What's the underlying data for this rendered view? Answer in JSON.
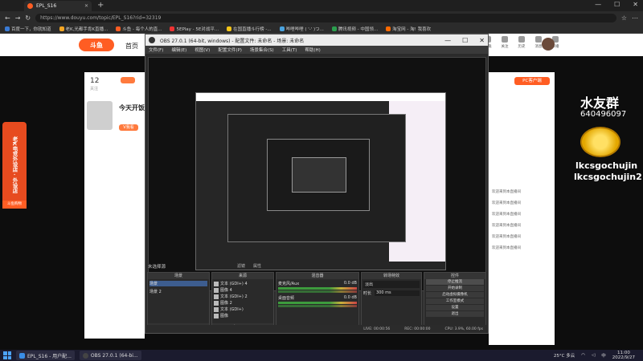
{
  "browser": {
    "tab_title": "EPL_S16",
    "new_tab": "+",
    "url": "https://www.douyu.com/topic/EPL_S16?rid=32319",
    "bookmarks": [
      "百度一下，你就知道",
      "老K,光都手肯K直播...",
      "斗鱼 - 每个人的直...",
      "5EPlay - 5E对战平...",
      "在国直播斗行榜 -...",
      "哔哩哔哩 ( '-' )つ...",
      "腾讯视频 - 中国领...",
      "淘宝网 - 淘! 我喜欢"
    ],
    "window_controls": [
      "—",
      "☐",
      "✕"
    ]
  },
  "site": {
    "logo": "斗鱼",
    "home": "首页",
    "header_icons": [
      "下载",
      "关注",
      "历史",
      "消息",
      "开播"
    ],
    "fans_count": "12",
    "fans_label": "关注",
    "today_title": "今天开饭",
    "v_button": "V我看",
    "left_banner": "老K电竞外设店 · 外设店",
    "left_banner_btn": "斗鱼购物",
    "pc_client_btn": "PC客户端",
    "chat_lines": [
      "欢迎来到本直播间",
      "欢迎来到本直播间",
      "欢迎来到本直播间",
      "欢迎来到本直播间",
      "欢迎来到本直播间",
      "欢迎来到本直播间"
    ],
    "overlay_name": "水友群",
    "overlay_id": "640496097",
    "overlay_user1": "lkcsgochujin",
    "overlay_user2": "lkcsgochujin2"
  },
  "obs": {
    "title": "OBS 27.0.1 (64-bit, windows) - 配置文件: 未命名 - 场景: 未命名",
    "menu": [
      "文件(F)",
      "编辑(E)",
      "视图(V)",
      "配置文件(P)",
      "场景集合(S)",
      "工具(T)",
      "帮助(H)"
    ],
    "no_scene": "未选择源",
    "filters": "滤镜",
    "properties": "属性",
    "docks": {
      "scenes": {
        "title": "场景",
        "items": [
          "场景",
          "场景 2"
        ]
      },
      "sources": {
        "title": "来源",
        "items": [
          "文本 (GDI+) 4",
          "图像 4",
          "文本 (GDI+) 2",
          "图像 2",
          "文本 (GDI+)",
          "图像"
        ]
      },
      "mixer": {
        "title": "混音器",
        "tracks": [
          {
            "name": "麦克风/Aux",
            "db": "0.0 dB"
          },
          {
            "name": "桌面音频",
            "db": "0.0 dB"
          }
        ]
      },
      "transitions": {
        "title": "转场特效",
        "type": "淡出",
        "duration_label": "时长",
        "duration": "300 ms"
      },
      "controls": {
        "title": "控件",
        "buttons": [
          "停止推流",
          "开始录制",
          "启动虚拟摄像机",
          "工作室模式",
          "设置",
          "退出"
        ]
      }
    },
    "footer": {
      "live": "LIVE: 00:00:56",
      "rec": "REC: 00:00:00",
      "cpu": "CPU: 3.9%, 60.00 fps"
    }
  },
  "taskbar": {
    "items": [
      "EPL_S16 - 用户配...",
      "OBS 27.0.1 (64-bi..."
    ],
    "weather": "25°C 多云",
    "lang": "中",
    "time": "11:00",
    "date": "2022/9/27"
  },
  "colors": {
    "accent": "#ff5d23",
    "obs_bg": "#2b2b2b",
    "taskbar": "#1b1b2e"
  }
}
